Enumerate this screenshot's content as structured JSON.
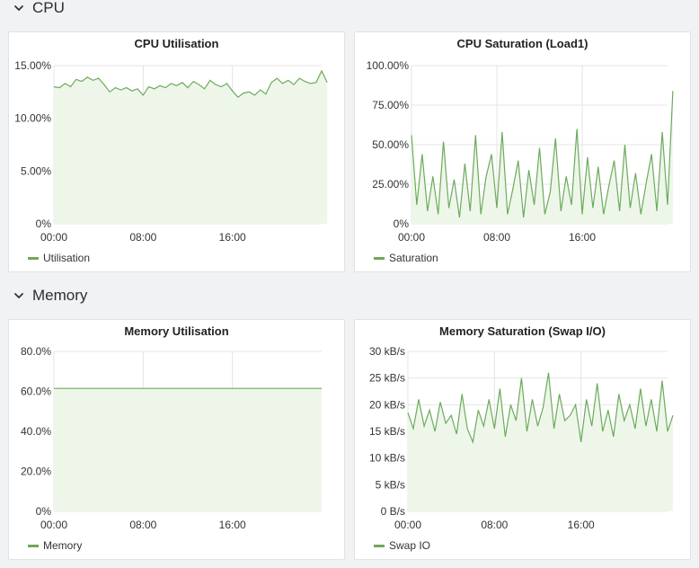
{
  "colors": {
    "series": "#6cab5c",
    "fill": "#eef6ea",
    "grid": "#e4e4e4",
    "background": "#f1f2f4"
  },
  "sections": [
    {
      "title": "CPU",
      "icon": "chevron-down-icon"
    },
    {
      "title": "Memory",
      "icon": "chevron-down-icon"
    }
  ],
  "chart_data": [
    {
      "type": "area",
      "title": "CPU Utilisation",
      "xticks": [
        "00:00",
        "08:00",
        "16:00"
      ],
      "yticks": [
        "0%",
        "5.00%",
        "10.00%",
        "15.00%"
      ],
      "ylim": [
        0,
        15
      ],
      "xlim": [
        0,
        24
      ],
      "series": [
        {
          "name": "Utilisation",
          "x": [
            0,
            0.5,
            1,
            1.5,
            2,
            2.5,
            3,
            3.5,
            4,
            4.5,
            5,
            5.5,
            6,
            6.5,
            7,
            7.5,
            8,
            8.5,
            9,
            9.5,
            10,
            10.5,
            11,
            11.5,
            12,
            12.5,
            13,
            13.5,
            14,
            14.5,
            15,
            15.5,
            16,
            16.5,
            17,
            17.5,
            18,
            18.5,
            19,
            19.5,
            20,
            20.5,
            21,
            21.5,
            22,
            22.5,
            23,
            23.5,
            24,
            24.5
          ],
          "values": [
            13.0,
            12.9,
            13.3,
            13.0,
            13.7,
            13.5,
            13.9,
            13.6,
            13.8,
            13.2,
            12.5,
            12.9,
            12.7,
            12.9,
            12.6,
            12.8,
            12.2,
            13.0,
            12.8,
            13.1,
            12.9,
            13.3,
            13.1,
            13.4,
            12.9,
            13.5,
            13.2,
            12.8,
            13.6,
            13.2,
            13.0,
            13.3,
            12.6,
            12.0,
            12.4,
            12.5,
            12.2,
            12.7,
            12.3,
            13.4,
            13.8,
            13.3,
            13.6,
            13.2,
            13.8,
            13.5,
            13.3,
            13.4,
            14.5,
            13.4
          ]
        }
      ]
    },
    {
      "type": "line",
      "title": "CPU Saturation (Load1)",
      "xticks": [
        "00:00",
        "08:00",
        "16:00"
      ],
      "yticks": [
        "0%",
        "25.00%",
        "50.00%",
        "75.00%",
        "100.00%"
      ],
      "ylim": [
        0,
        100
      ],
      "xlim": [
        0,
        24
      ],
      "series": [
        {
          "name": "Saturation",
          "x": [
            0,
            0.5,
            1,
            1.5,
            2,
            2.5,
            3,
            3.5,
            4,
            4.5,
            5,
            5.5,
            6,
            6.5,
            7,
            7.5,
            8,
            8.5,
            9,
            9.5,
            10,
            10.5,
            11,
            11.5,
            12,
            12.5,
            13,
            13.5,
            14,
            14.5,
            15,
            15.5,
            16,
            16.5,
            17,
            17.5,
            18,
            18.5,
            19,
            19.5,
            20,
            20.5,
            21,
            21.5,
            22,
            22.5,
            23,
            23.5,
            24,
            24.5
          ],
          "values": [
            56,
            12,
            44,
            8,
            30,
            6,
            52,
            10,
            28,
            4,
            38,
            8,
            56,
            6,
            30,
            44,
            10,
            58,
            6,
            22,
            40,
            4,
            34,
            12,
            48,
            6,
            20,
            54,
            8,
            30,
            12,
            60,
            6,
            42,
            10,
            36,
            6,
            24,
            40,
            8,
            50,
            10,
            32,
            6,
            26,
            44,
            8,
            58,
            12,
            84
          ]
        }
      ]
    },
    {
      "type": "area",
      "title": "Memory Utilisation",
      "xticks": [
        "00:00",
        "08:00",
        "16:00"
      ],
      "yticks": [
        "0%",
        "20.0%",
        "40.0%",
        "60.0%",
        "80.0%"
      ],
      "ylim": [
        0,
        80
      ],
      "xlim": [
        0,
        24
      ],
      "series": [
        {
          "name": "Memory",
          "x": [
            0,
            24
          ],
          "values": [
            61.5,
            61.5
          ]
        }
      ]
    },
    {
      "type": "line",
      "title": "Memory Saturation (Swap I/O)",
      "xticks": [
        "00:00",
        "08:00",
        "16:00"
      ],
      "yticks": [
        "0 B/s",
        "5 kB/s",
        "10 kB/s",
        "15 kB/s",
        "20 kB/s",
        "25 kB/s",
        "30 kB/s"
      ],
      "ylim": [
        0,
        30
      ],
      "xlim": [
        0,
        24
      ],
      "series": [
        {
          "name": "Swap IO",
          "x": [
            0,
            0.5,
            1,
            1.5,
            2,
            2.5,
            3,
            3.5,
            4,
            4.5,
            5,
            5.5,
            6,
            6.5,
            7,
            7.5,
            8,
            8.5,
            9,
            9.5,
            10,
            10.5,
            11,
            11.5,
            12,
            12.5,
            13,
            13.5,
            14,
            14.5,
            15,
            15.5,
            16,
            16.5,
            17,
            17.5,
            18,
            18.5,
            19,
            19.5,
            20,
            20.5,
            21,
            21.5,
            22,
            22.5,
            23,
            23.5,
            24,
            24.5
          ],
          "values": [
            18.5,
            15.5,
            21,
            16,
            19,
            15,
            20.5,
            16.5,
            18,
            14.5,
            22,
            15.5,
            13,
            19,
            16,
            21,
            15.5,
            23,
            14,
            20,
            17,
            25,
            15,
            21,
            16,
            19.5,
            26,
            15.5,
            22,
            17,
            18,
            20,
            13,
            21,
            16,
            24,
            15,
            19,
            14,
            22,
            17,
            20,
            15.5,
            23,
            16,
            21,
            15,
            24.5,
            15,
            18
          ]
        }
      ]
    }
  ]
}
